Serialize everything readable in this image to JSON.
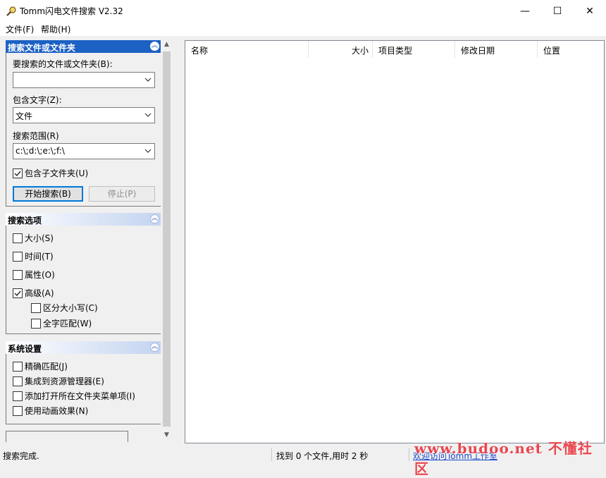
{
  "window": {
    "title": "Tomm闪电文件搜索 V2.32",
    "minimize": "—",
    "maximize": "☐",
    "close": "✕"
  },
  "menu": {
    "file": "文件(F)",
    "help": "帮助(H)"
  },
  "search_panel": {
    "title": "搜索文件或文件夹",
    "file_label": "要搜索的文件或文件夹(B):",
    "file_value": "",
    "text_label": "包含文字(Z):",
    "text_value": "文件",
    "scope_label": "搜索范围(R)",
    "scope_value": "c:\\;d:\\;e:\\;f:\\",
    "include_sub": {
      "label": "包含子文件夹(U)",
      "checked": true
    },
    "start_button": "开始搜索(B)",
    "stop_button": "停止(P)"
  },
  "options_panel": {
    "title": "搜索选项",
    "items": [
      {
        "label": "大小(S)",
        "checked": false
      },
      {
        "label": "时间(T)",
        "checked": false
      },
      {
        "label": "属性(O)",
        "checked": false
      },
      {
        "label": "高级(A)",
        "checked": true
      }
    ],
    "advanced_items": [
      {
        "label": "区分大小写(C)",
        "checked": false
      },
      {
        "label": "全字匹配(W)",
        "checked": false
      }
    ]
  },
  "system_panel": {
    "title": "系统设置",
    "items": [
      {
        "label": "精确匹配(J)",
        "checked": false
      },
      {
        "label": "集成到资源管理器(E)",
        "checked": false
      },
      {
        "label": "添加打开所在文件夹菜单项(I)",
        "checked": false
      },
      {
        "label": "使用动画效果(N)",
        "checked": false
      }
    ]
  },
  "list": {
    "columns": [
      "名称",
      "大小",
      "项目类型",
      "修改日期",
      "位置"
    ]
  },
  "status": {
    "left": "搜索完成.",
    "middle": "找到 0 个文件,用时 2 秒",
    "link": "欢迎访问Tomm工作室",
    "watermark": "www.budoo.net 不懂社区"
  },
  "colors": {
    "panel_header_blue": "#1c61c4",
    "link": "#1a47c8",
    "watermark": "#e8474f"
  }
}
